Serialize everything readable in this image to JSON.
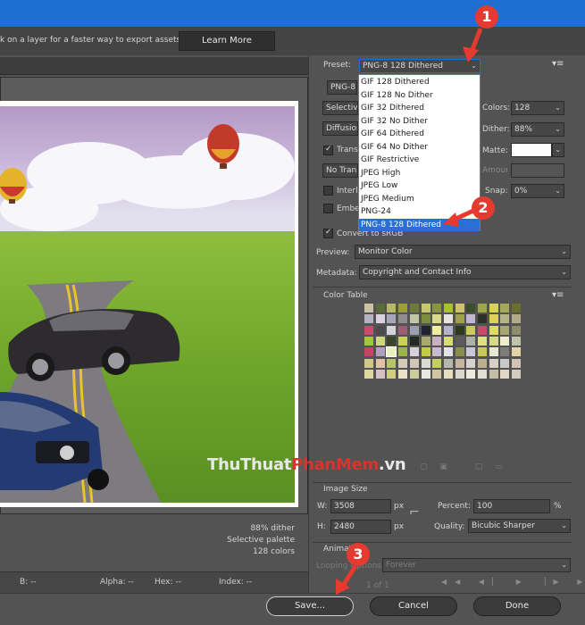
{
  "infobar": {
    "message": "k on a layer for a faster way to export assets",
    "learn_more": "Learn More"
  },
  "preview": {
    "stats": [
      "88% dither",
      "Selective palette",
      "128 colors"
    ],
    "status": {
      "r": "",
      "g": "",
      "b": "B: --",
      "alpha": "Alpha: --",
      "hex": "Hex: --",
      "index": "Index: --"
    }
  },
  "settings": {
    "preset_label": "Preset:",
    "preset_value": "PNG-8 128 Dithered",
    "format_value": "PNG-8",
    "reduction_value": "Selective",
    "dither_algo_value": "Diffusion",
    "transparency_label": "Transparency",
    "matte_dither_value": "No Transparency Dither",
    "interlaced_label": "Interlaced",
    "embed_label": "Embed Color Profile",
    "colors_label": "Colors:",
    "colors_value": "128",
    "dither_label": "Dither:",
    "dither_value": "88%",
    "matte_label": "Matte:",
    "amount_label": "Amount:",
    "snap_label": "Snap:",
    "snap_value": "0%",
    "convert_label": "Convert to sRGB",
    "preview_label": "Preview:",
    "preview_value": "Monitor Color",
    "metadata_label": "Metadata:",
    "metadata_value": "Copyright and Contact Info"
  },
  "preset_options": [
    "GIF 128 Dithered",
    "GIF 128 No Dither",
    "GIF 32 Dithered",
    "GIF 32 No Dither",
    "GIF 64 Dithered",
    "GIF 64 No Dither",
    "GIF Restrictive",
    "JPEG High",
    "JPEG Low",
    "JPEG Medium",
    "PNG-24",
    "PNG-8 128 Dithered"
  ],
  "color_table": {
    "title": "Color Table",
    "colors": [
      "#c9c4a8",
      "#5a6b3a",
      "#b7b86a",
      "#9c9e33",
      "#6f7a3c",
      "#c5c86c",
      "#8a9340",
      "#a8c034",
      "#d2c16b",
      "#3c4d2c",
      "#9ea54a",
      "#d7d35a",
      "#a4a85b",
      "#6a6f2e",
      "#b9b0c0",
      "#d8d2e0",
      "#a9a6bb",
      "#8f8c8e",
      "#c1c6a4",
      "#7c8b3e",
      "#dcd98b",
      "#e6e4dc",
      "#9fa04b",
      "#c3b7d0",
      "#2e2f29",
      "#ddd062",
      "#b5b389",
      "#b4a989",
      "#c94c6d",
      "#4a4c4f",
      "#d5d3da",
      "#9f5a74",
      "#9b9eb0",
      "#1f2330",
      "#f0ed9e",
      "#b6b4cc",
      "#2d3a1c",
      "#cdcb52",
      "#c74b6a",
      "#deda66",
      "#a8a673",
      "#8f8c6d",
      "#a5c53a",
      "#cfd77c",
      "#3a4528",
      "#cdd150",
      "#242923",
      "#a9a873",
      "#c7b0c1",
      "#d9dd70",
      "#5d5a5c",
      "#aeb2a6",
      "#e0df8a",
      "#d9db84",
      "#f1eccf",
      "#bfc3a9",
      "#c64565",
      "#b29ebf",
      "#eaf0c0",
      "#9bb44a",
      "#d7cfdc",
      "#c4cc44",
      "#c8b8d0",
      "#e3e2e8",
      "#8b8e46",
      "#c9c7d7",
      "#ccc55a",
      "#e7e9d2",
      "#7e7c7a",
      "#e4d3a6",
      "#d0c78d",
      "#e3c0a6",
      "#b9c46a",
      "#d7c9b9",
      "#d1c6b8",
      "#dcdad5",
      "#c4cf62",
      "#b7b8ad",
      "#c7b5a0",
      "#d4d1ce",
      "#bbb090",
      "#d6d0c7",
      "#c9c9c9",
      "#d1c3b5",
      "#ddd7a1",
      "#d8c0c7",
      "#cfcd7e",
      "#eae3c9",
      "#d0cc9a",
      "#e9e7e2",
      "#d3c5a2",
      "#e4dfbf",
      "#dcd8c9",
      "#eeeadd",
      "#e2dfd0",
      "#c6bda6",
      "#e0d7c7",
      "#d6ccbe"
    ],
    "selected_index": 58
  },
  "image_size": {
    "title": "Image Size",
    "w_label": "W:",
    "w_value": "3508",
    "h_label": "H:",
    "h_value": "2480",
    "unit": "px",
    "percent_label": "Percent:",
    "percent_value": "100",
    "percent_unit": "%",
    "quality_label": "Quality:",
    "quality_value": "Bicubic Sharper"
  },
  "animation": {
    "title": "Animation",
    "looping_label": "Looping Options:",
    "looping_value": "Forever",
    "frame_counter": "1 of 1"
  },
  "buttons": {
    "save": "Save...",
    "cancel": "Cancel",
    "done": "Done"
  },
  "markers": [
    "1",
    "2",
    "3"
  ],
  "watermark": {
    "part1": "ThuThuat",
    "part2": "PhanMem",
    "part3": ".vn"
  },
  "accent": "#1e6fd1"
}
